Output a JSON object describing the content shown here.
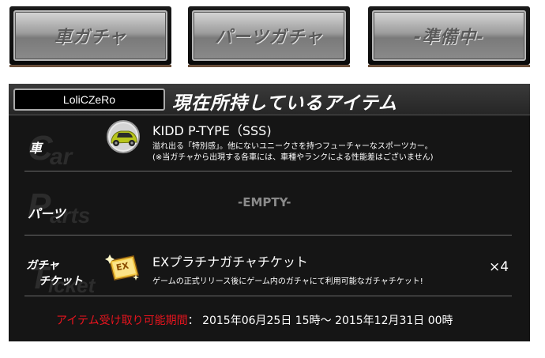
{
  "tabs": [
    {
      "label": "車ガチャ"
    },
    {
      "label": "パーツガチャ"
    },
    {
      "label": "-準備中-"
    }
  ],
  "panel": {
    "username": "LoliCZeRo",
    "title": "現在所持しているアイテム"
  },
  "rows": {
    "car": {
      "label": "車",
      "bg_text": [
        "C",
        "ar"
      ],
      "name": "KIDD P-TYPE（SSS)",
      "desc1": "溢れ出る「特別感」。他にないユニークさを持つフューチャーなスポーツカー。",
      "desc2": "(※当ガチャから出現する各車には、車種やランクによる性能差はございません)"
    },
    "parts": {
      "label": "パーツ",
      "bg_text": [
        "P",
        "arts"
      ],
      "empty": "-EMPTY-"
    },
    "ticket": {
      "label1": "ガチャ",
      "label2": "チケット",
      "bg_text": [
        "T",
        "icket"
      ],
      "badge": "EX",
      "name": "EXプラチナガチャチケット",
      "desc": "ゲームの正式リリース後にゲーム内のガチャにて利用可能なガチャチケット!",
      "quantity": "×4"
    }
  },
  "period": {
    "label": "アイテム受け取り可能期間",
    "separator": "：",
    "value": "2015年06月25日 15時～ 2015年12月31日 00時"
  },
  "colors": {
    "panel_bg": "#151515",
    "accent_red": "#e8141e",
    "tab_text": "#5a5a5a"
  }
}
